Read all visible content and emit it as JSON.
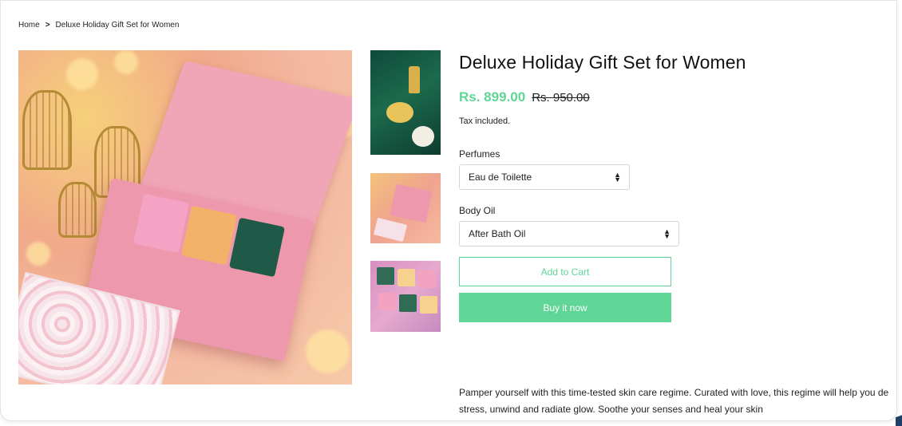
{
  "breadcrumb": {
    "home": "Home",
    "separator": ">",
    "current": "Deluxe Holiday Gift Set for Women"
  },
  "product": {
    "title": "Deluxe Holiday Gift Set for Women",
    "price_sale": "Rs. 899.00",
    "price_regular": "Rs. 950.00",
    "tax_note": "Tax included.",
    "options": {
      "perfume_label": "Perfumes",
      "perfume_value": "Eau de Toilette",
      "oil_label": "Body Oil",
      "oil_value": "After Bath Oil"
    },
    "add_to_cart": "Add to Cart",
    "buy_now": "Buy it now",
    "description": "Pamper yourself with this time-tested skin care regime. Curated with love, this regime will help you de stress, unwind and radiate glow. Soothe your senses and heal your skin"
  },
  "colors": {
    "accent": "#5fd596",
    "text": "#111111"
  },
  "icons": {
    "select_arrows": "up-down-arrows-icon",
    "breadcrumb_sep": "chevron-right-icon"
  }
}
